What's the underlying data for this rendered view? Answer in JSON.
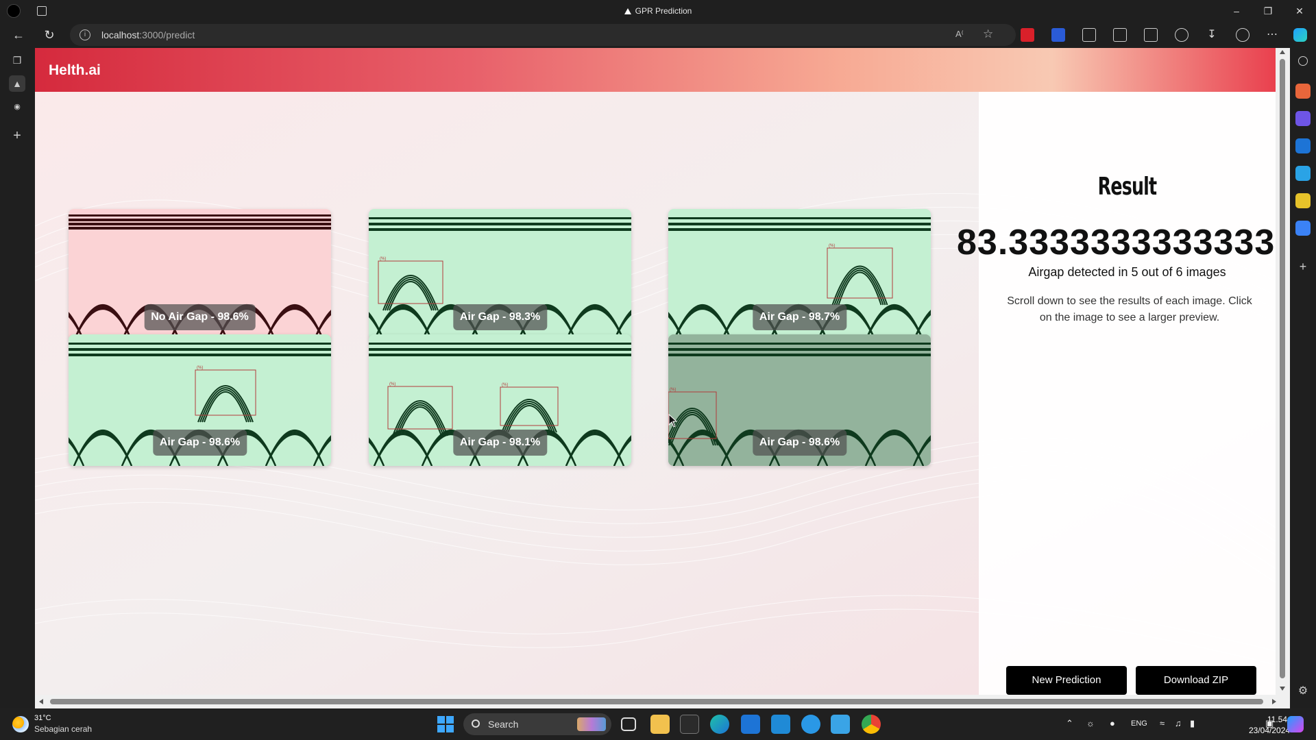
{
  "browser": {
    "tab_title": "GPR Prediction",
    "url_host": "localhost",
    "url_path": ":3000/predict"
  },
  "app": {
    "logo": "Helth.ai"
  },
  "result": {
    "title": "Result",
    "value": "83.33333333333334",
    "summary": "Airgap detected in 5 out of 6 images",
    "description": "Scroll down to see the results of each image. Click on the image to see a larger preview.",
    "new_prediction_label": "New Prediction",
    "download_label": "Download ZIP"
  },
  "images": [
    {
      "label": "No Air Gap - 98.6%",
      "status": "no-airgap",
      "bg": "#fbd3d5",
      "line": "#3a0f12"
    },
    {
      "label": "Air Gap - 98.3%",
      "status": "airgap",
      "bg": "#c4f0d2",
      "line": "#0f3a1e"
    },
    {
      "label": "Air Gap - 98.7%",
      "status": "airgap",
      "bg": "#c4f0d2",
      "line": "#0f3a1e"
    },
    {
      "label": "Air Gap - 98.6%",
      "status": "airgap",
      "bg": "#c4f0d2",
      "line": "#0f3a1e"
    },
    {
      "label": "Air Gap - 98.1%",
      "status": "airgap",
      "bg": "#c4f0d2",
      "line": "#0f3a1e"
    },
    {
      "label": "Air Gap - 98.6%",
      "status": "airgap-hover",
      "bg": "#93b39c",
      "line": "#0f3a1e"
    }
  ],
  "taskbar": {
    "temperature": "31°C",
    "weather": "Sebagian cerah",
    "search_placeholder": "Search",
    "language": "ENG",
    "time": "11.54",
    "date": "23/04/2024"
  }
}
